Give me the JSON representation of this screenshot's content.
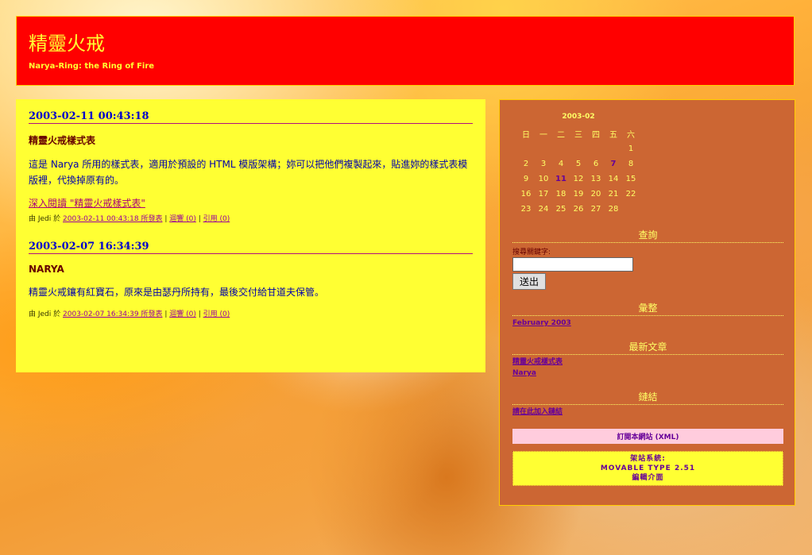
{
  "header": {
    "title": "精靈火戒",
    "tagline": "Narya-Ring: the Ring of Fire"
  },
  "entries": [
    {
      "date": "2003-02-11 00:43:18",
      "title": "精靈火戒樣式表",
      "body": "這是 Narya 所用的樣式表，適用於預設的 HTML 模版架構；妳可以把他們複製起來，貼進妳的樣式表模版裡，代換掉原有的。",
      "more": "深入閱讀 \"精靈火戒樣式表\"",
      "by": "由 Jedi 於",
      "permalink": "2003-02-11 00:43:18 所發表",
      "comments": "迴響 (0)",
      "trackback": "引用 (0)"
    },
    {
      "date": "2003-02-07 16:34:39",
      "title": "NARYA",
      "body": "精靈火戒鑲有紅寶石，原來是由瑟丹所持有，最後交付給甘道夫保管。",
      "by": "由 Jedi 於",
      "permalink": "2003-02-07 16:34:39 所發表",
      "comments": "迴響 (0)",
      "trackback": "引用 (0)"
    }
  ],
  "calendar": {
    "caption": "2003-02",
    "weekdays": [
      "日",
      "一",
      "二",
      "三",
      "四",
      "五",
      "六"
    ],
    "weeks": [
      [
        "",
        "",
        "",
        "",
        "",
        "",
        "1"
      ],
      [
        "2",
        "3",
        "4",
        "5",
        "6",
        "7",
        "8"
      ],
      [
        "9",
        "10",
        "11",
        "12",
        "13",
        "14",
        "15"
      ],
      [
        "16",
        "17",
        "18",
        "19",
        "20",
        "21",
        "22"
      ],
      [
        "23",
        "24",
        "25",
        "26",
        "27",
        "28",
        ""
      ]
    ],
    "linked_days": [
      "7",
      "11"
    ]
  },
  "sidebar": {
    "search_title": "查詢",
    "search_label": "搜尋關鍵字:",
    "search_button": "送出",
    "archives_title": "彙整",
    "archives": [
      "February 2003"
    ],
    "recent_title": "最新文章",
    "recent": [
      "精靈火戒樣式表",
      "Narya"
    ],
    "links_title": "鏈結",
    "links": [
      "請在此加入鏈結"
    ],
    "syndicate": "訂閱本網站 (XML)",
    "powered_line1": "架站系統:",
    "powered_line2": "MOVABLE TYPE 2.51",
    "powered_line3": "編輯介面"
  },
  "colors": {
    "header_bg": "#ff0000",
    "main_bg": "#ffff33",
    "sidebar_bg": "#cc6633",
    "accent_text": "#ffff33"
  }
}
